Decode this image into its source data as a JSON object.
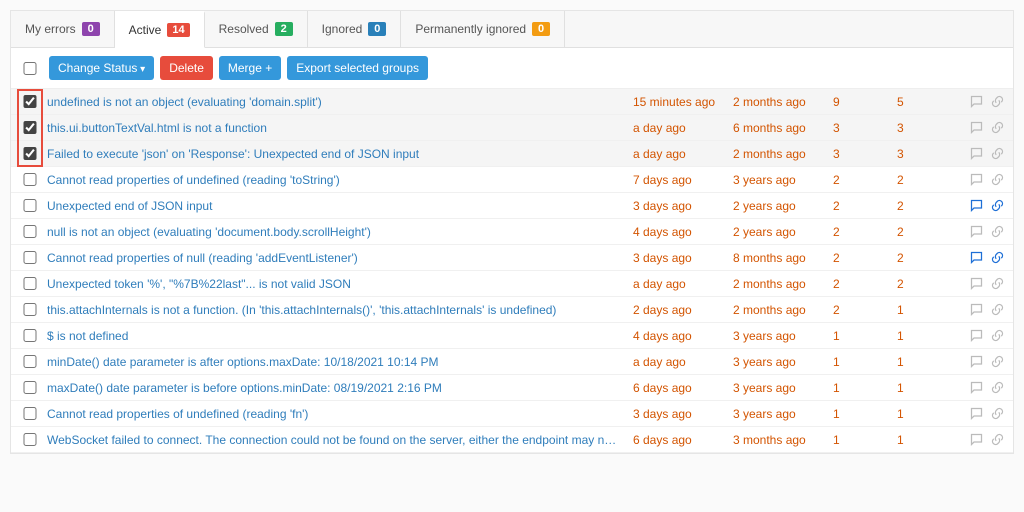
{
  "tabs": [
    {
      "label": "My errors",
      "count": "0",
      "badge": "b-purple",
      "active": false
    },
    {
      "label": "Active",
      "count": "14",
      "badge": "b-red",
      "active": true
    },
    {
      "label": "Resolved",
      "count": "2",
      "badge": "b-green",
      "active": false
    },
    {
      "label": "Ignored",
      "count": "0",
      "badge": "b-blue",
      "active": false
    },
    {
      "label": "Permanently ignored",
      "count": "0",
      "badge": "b-orange",
      "active": false
    }
  ],
  "toolbar": {
    "change_status": "Change Status",
    "delete": "Delete",
    "merge": "Merge",
    "export": "Export selected groups"
  },
  "rows": [
    {
      "sel": true,
      "title": "undefined is not an object (evaluating 'domain.split')",
      "last": "15 minutes ago",
      "first": "2 months ago",
      "c1": "9",
      "c2": "5",
      "hot": false
    },
    {
      "sel": true,
      "title": "this.ui.buttonTextVal.html is not a function",
      "last": "a day ago",
      "first": "6 months ago",
      "c1": "3",
      "c2": "3",
      "hot": false
    },
    {
      "sel": true,
      "title": "Failed to execute 'json' on 'Response': Unexpected end of JSON input",
      "last": "a day ago",
      "first": "2 months ago",
      "c1": "3",
      "c2": "3",
      "hot": false
    },
    {
      "sel": false,
      "title": "Cannot read properties of undefined (reading 'toString')",
      "last": "7 days ago",
      "first": "3 years ago",
      "c1": "2",
      "c2": "2",
      "hot": false
    },
    {
      "sel": false,
      "title": "Unexpected end of JSON input",
      "last": "3 days ago",
      "first": "2 years ago",
      "c1": "2",
      "c2": "2",
      "hot": true
    },
    {
      "sel": false,
      "title": "null is not an object (evaluating 'document.body.scrollHeight')",
      "last": "4 days ago",
      "first": "2 years ago",
      "c1": "2",
      "c2": "2",
      "hot": false
    },
    {
      "sel": false,
      "title": "Cannot read properties of null (reading 'addEventListener')",
      "last": "3 days ago",
      "first": "8 months ago",
      "c1": "2",
      "c2": "2",
      "hot": true
    },
    {
      "sel": false,
      "title": "Unexpected token '%', \"%7B%22last\"... is not valid JSON",
      "last": "a day ago",
      "first": "2 months ago",
      "c1": "2",
      "c2": "2",
      "hot": false
    },
    {
      "sel": false,
      "title": "this.attachInternals is not a function. (In 'this.attachInternals()', 'this.attachInternals' is undefined)",
      "last": "2 days ago",
      "first": "2 months ago",
      "c1": "2",
      "c2": "1",
      "hot": false
    },
    {
      "sel": false,
      "title": "$ is not defined",
      "last": "4 days ago",
      "first": "3 years ago",
      "c1": "1",
      "c2": "1",
      "hot": false
    },
    {
      "sel": false,
      "title": "minDate() date parameter is after options.maxDate: 10/18/2021 10:14 PM",
      "last": "a day ago",
      "first": "3 years ago",
      "c1": "1",
      "c2": "1",
      "hot": false
    },
    {
      "sel": false,
      "title": "maxDate() date parameter is before options.minDate: 08/19/2021 2:16 PM",
      "last": "6 days ago",
      "first": "3 years ago",
      "c1": "1",
      "c2": "1",
      "hot": false
    },
    {
      "sel": false,
      "title": "Cannot read properties of undefined (reading 'fn')",
      "last": "3 days ago",
      "first": "3 years ago",
      "c1": "1",
      "c2": "1",
      "hot": false
    },
    {
      "sel": false,
      "title": "WebSocket failed to connect. The connection could not be found on the server, either the endpoint may not be a SignalR endpoint, the connection ID i...",
      "last": "6 days ago",
      "first": "3 months ago",
      "c1": "1",
      "c2": "1",
      "hot": false
    }
  ]
}
